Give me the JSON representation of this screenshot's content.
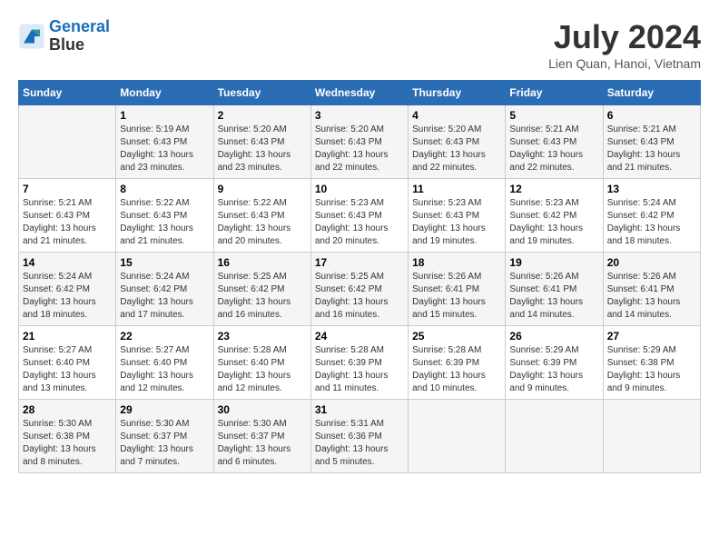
{
  "header": {
    "logo_line1": "General",
    "logo_line2": "Blue",
    "month_title": "July 2024",
    "location": "Lien Quan, Hanoi, Vietnam"
  },
  "days_of_week": [
    "Sunday",
    "Monday",
    "Tuesday",
    "Wednesday",
    "Thursday",
    "Friday",
    "Saturday"
  ],
  "weeks": [
    [
      {
        "day": "",
        "info": ""
      },
      {
        "day": "1",
        "info": "Sunrise: 5:19 AM\nSunset: 6:43 PM\nDaylight: 13 hours\nand 23 minutes."
      },
      {
        "day": "2",
        "info": "Sunrise: 5:20 AM\nSunset: 6:43 PM\nDaylight: 13 hours\nand 23 minutes."
      },
      {
        "day": "3",
        "info": "Sunrise: 5:20 AM\nSunset: 6:43 PM\nDaylight: 13 hours\nand 22 minutes."
      },
      {
        "day": "4",
        "info": "Sunrise: 5:20 AM\nSunset: 6:43 PM\nDaylight: 13 hours\nand 22 minutes."
      },
      {
        "day": "5",
        "info": "Sunrise: 5:21 AM\nSunset: 6:43 PM\nDaylight: 13 hours\nand 22 minutes."
      },
      {
        "day": "6",
        "info": "Sunrise: 5:21 AM\nSunset: 6:43 PM\nDaylight: 13 hours\nand 21 minutes."
      }
    ],
    [
      {
        "day": "7",
        "info": "Sunrise: 5:21 AM\nSunset: 6:43 PM\nDaylight: 13 hours\nand 21 minutes."
      },
      {
        "day": "8",
        "info": "Sunrise: 5:22 AM\nSunset: 6:43 PM\nDaylight: 13 hours\nand 21 minutes."
      },
      {
        "day": "9",
        "info": "Sunrise: 5:22 AM\nSunset: 6:43 PM\nDaylight: 13 hours\nand 20 minutes."
      },
      {
        "day": "10",
        "info": "Sunrise: 5:23 AM\nSunset: 6:43 PM\nDaylight: 13 hours\nand 20 minutes."
      },
      {
        "day": "11",
        "info": "Sunrise: 5:23 AM\nSunset: 6:43 PM\nDaylight: 13 hours\nand 19 minutes."
      },
      {
        "day": "12",
        "info": "Sunrise: 5:23 AM\nSunset: 6:42 PM\nDaylight: 13 hours\nand 19 minutes."
      },
      {
        "day": "13",
        "info": "Sunrise: 5:24 AM\nSunset: 6:42 PM\nDaylight: 13 hours\nand 18 minutes."
      }
    ],
    [
      {
        "day": "14",
        "info": "Sunrise: 5:24 AM\nSunset: 6:42 PM\nDaylight: 13 hours\nand 18 minutes."
      },
      {
        "day": "15",
        "info": "Sunrise: 5:24 AM\nSunset: 6:42 PM\nDaylight: 13 hours\nand 17 minutes."
      },
      {
        "day": "16",
        "info": "Sunrise: 5:25 AM\nSunset: 6:42 PM\nDaylight: 13 hours\nand 16 minutes."
      },
      {
        "day": "17",
        "info": "Sunrise: 5:25 AM\nSunset: 6:42 PM\nDaylight: 13 hours\nand 16 minutes."
      },
      {
        "day": "18",
        "info": "Sunrise: 5:26 AM\nSunset: 6:41 PM\nDaylight: 13 hours\nand 15 minutes."
      },
      {
        "day": "19",
        "info": "Sunrise: 5:26 AM\nSunset: 6:41 PM\nDaylight: 13 hours\nand 14 minutes."
      },
      {
        "day": "20",
        "info": "Sunrise: 5:26 AM\nSunset: 6:41 PM\nDaylight: 13 hours\nand 14 minutes."
      }
    ],
    [
      {
        "day": "21",
        "info": "Sunrise: 5:27 AM\nSunset: 6:40 PM\nDaylight: 13 hours\nand 13 minutes."
      },
      {
        "day": "22",
        "info": "Sunrise: 5:27 AM\nSunset: 6:40 PM\nDaylight: 13 hours\nand 12 minutes."
      },
      {
        "day": "23",
        "info": "Sunrise: 5:28 AM\nSunset: 6:40 PM\nDaylight: 13 hours\nand 12 minutes."
      },
      {
        "day": "24",
        "info": "Sunrise: 5:28 AM\nSunset: 6:39 PM\nDaylight: 13 hours\nand 11 minutes."
      },
      {
        "day": "25",
        "info": "Sunrise: 5:28 AM\nSunset: 6:39 PM\nDaylight: 13 hours\nand 10 minutes."
      },
      {
        "day": "26",
        "info": "Sunrise: 5:29 AM\nSunset: 6:39 PM\nDaylight: 13 hours\nand 9 minutes."
      },
      {
        "day": "27",
        "info": "Sunrise: 5:29 AM\nSunset: 6:38 PM\nDaylight: 13 hours\nand 9 minutes."
      }
    ],
    [
      {
        "day": "28",
        "info": "Sunrise: 5:30 AM\nSunset: 6:38 PM\nDaylight: 13 hours\nand 8 minutes."
      },
      {
        "day": "29",
        "info": "Sunrise: 5:30 AM\nSunset: 6:37 PM\nDaylight: 13 hours\nand 7 minutes."
      },
      {
        "day": "30",
        "info": "Sunrise: 5:30 AM\nSunset: 6:37 PM\nDaylight: 13 hours\nand 6 minutes."
      },
      {
        "day": "31",
        "info": "Sunrise: 5:31 AM\nSunset: 6:36 PM\nDaylight: 13 hours\nand 5 minutes."
      },
      {
        "day": "",
        "info": ""
      },
      {
        "day": "",
        "info": ""
      },
      {
        "day": "",
        "info": ""
      }
    ]
  ]
}
